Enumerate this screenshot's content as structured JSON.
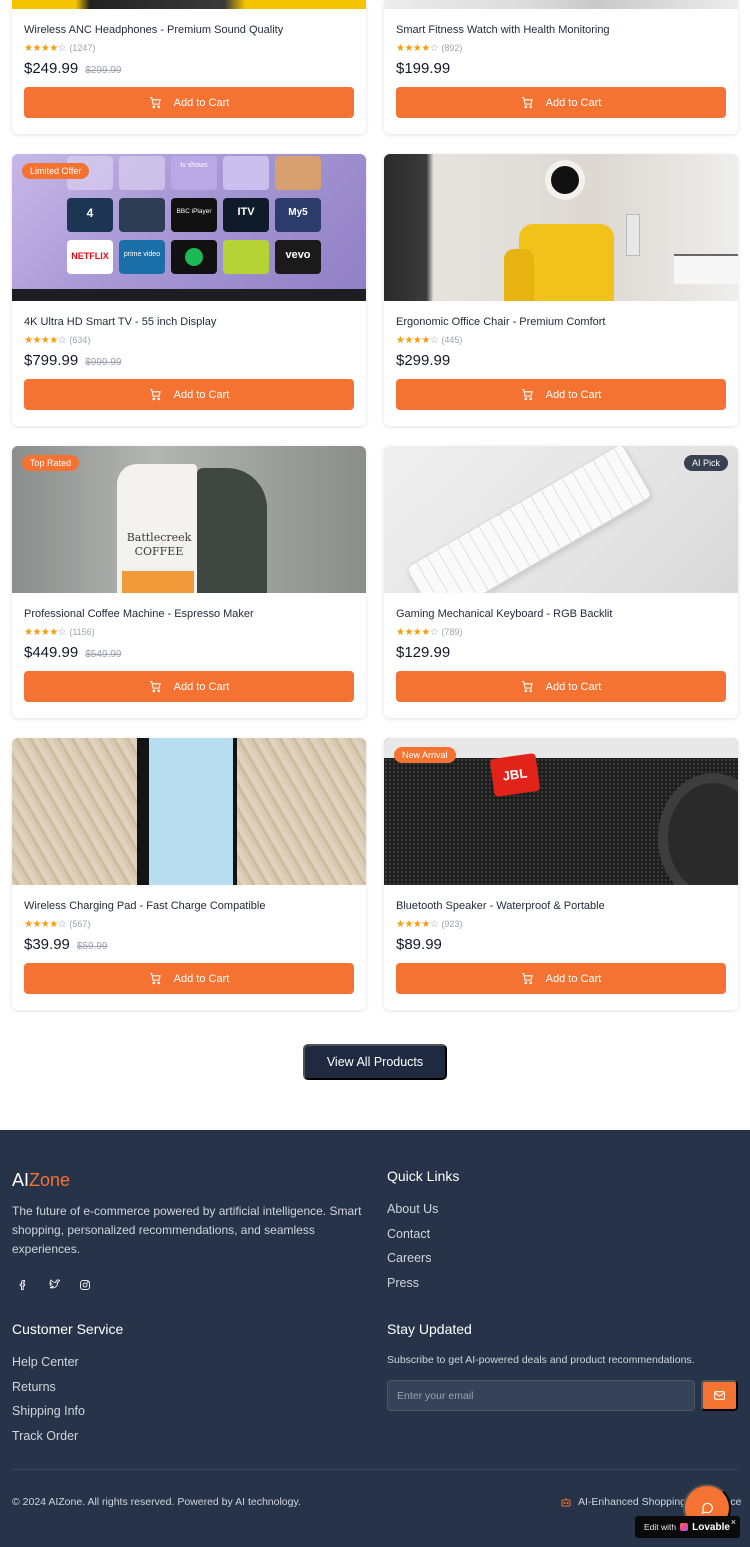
{
  "products": [
    {
      "title": "Wireless ANC Headphones - Premium Sound Quality",
      "stars": 4,
      "reviews": "(1247)",
      "price": "$249.99",
      "old_price": "$299.99",
      "badge": ""
    },
    {
      "title": "Smart Fitness Watch with Health Monitoring",
      "stars": 4,
      "reviews": "(892)",
      "price": "$199.99",
      "old_price": "",
      "badge": ""
    },
    {
      "title": "4K Ultra HD Smart TV - 55 inch Display",
      "stars": 4,
      "reviews": "(634)",
      "price": "$799.99",
      "old_price": "$999.99",
      "badge": "Limited Offer"
    },
    {
      "title": "Ergonomic Office Chair - Premium Comfort",
      "stars": 4,
      "reviews": "(445)",
      "price": "$299.99",
      "old_price": "",
      "badge": ""
    },
    {
      "title": "Professional Coffee Machine - Espresso Maker",
      "stars": 4,
      "reviews": "(1156)",
      "price": "$449.99",
      "old_price": "$549.99",
      "badge": "Top Rated"
    },
    {
      "title": "Gaming Mechanical Keyboard - RGB Backlit",
      "stars": 4,
      "reviews": "(789)",
      "price": "$129.99",
      "old_price": "",
      "badge": "AI Pick"
    },
    {
      "title": "Wireless Charging Pad - Fast Charge Compatible",
      "stars": 4,
      "reviews": "(567)",
      "price": "$39.99",
      "old_price": "$59.99",
      "badge": ""
    },
    {
      "title": "Bluetooth Speaker - Waterproof & Portable",
      "stars": 4,
      "reviews": "(923)",
      "price": "$89.99",
      "old_price": "",
      "badge": "New Arrival"
    }
  ],
  "add_to_cart_label": "Add to Cart",
  "view_all_label": "View All Products",
  "tv_tiles": [
    "tv shows",
    "4",
    "BBC iPlayer",
    "ITV",
    "My5",
    "NETFLIX",
    "prime video",
    "vevo"
  ],
  "coffee_bag_text": "Battlecreek COFFEE",
  "speaker_logo": "JBL",
  "footer": {
    "brand_ai": "AI",
    "brand_zone": "Zone",
    "tagline": "The future of e-commerce powered by artificial intelligence. Smart shopping, personalized recommendations, and seamless experiences.",
    "quick_links_title": "Quick Links",
    "quick_links": [
      "About Us",
      "Contact",
      "Careers",
      "Press"
    ],
    "customer_service_title": "Customer Service",
    "customer_service_links": [
      "Help Center",
      "Returns",
      "Shipping Info",
      "Track Order"
    ],
    "stay_updated_title": "Stay Updated",
    "subscribe_text": "Subscribe to get AI-powered deals and product recommendations.",
    "email_placeholder": "Enter your email",
    "copyright": "© 2024 AIZone. All rights reserved. Powered by AI technology.",
    "ai_enhanced": "AI-Enhanced Shopping Experience"
  },
  "lovable": {
    "edit_with": "Edit with",
    "brand": "Lovable",
    "close": "×"
  },
  "colors": {
    "accent": "#f47232",
    "footer_bg": "#263349",
    "dark_button": "#1f2a40"
  },
  "icons": [
    "shopping-cart-icon",
    "facebook-icon",
    "twitter-icon",
    "instagram-icon",
    "mail-icon",
    "bot-icon",
    "chat-icon"
  ]
}
